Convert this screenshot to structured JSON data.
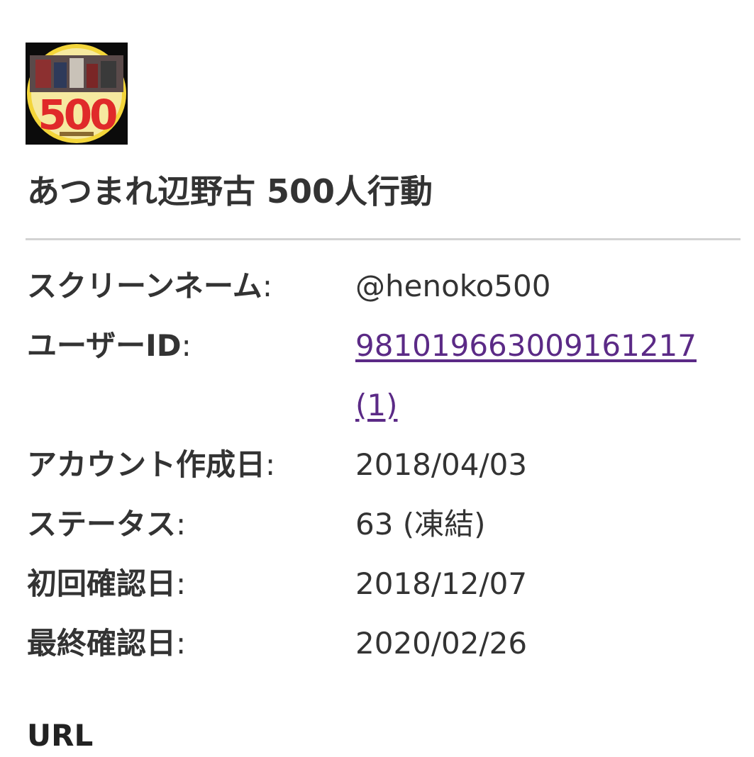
{
  "profile": {
    "avatar_icon": "profile-image-500",
    "avatar_text": "500",
    "avatar_colors": {
      "background": "#0b0b0b",
      "ring": "#f3d53a",
      "numeral": "#e02a2a"
    },
    "account_name": "あつまれ辺野古 500人行動"
  },
  "info": {
    "screen_name_label": "スクリーンネーム",
    "screen_name_value": "@henoko500",
    "user_id_label": "ユーザーID",
    "user_id_value": "981019663009161217",
    "user_id_count": "(1)",
    "created_label": "アカウント作成日",
    "created_value": "2018/04/03",
    "status_label": "ステータス",
    "status_value": "63 (凍結)",
    "first_seen_label": "初回確認日",
    "first_seen_value": "2018/12/07",
    "last_seen_label": "最終確認日",
    "last_seen_value": "2020/02/26",
    "colon": ":"
  },
  "sections": {
    "url_heading": "URL"
  },
  "colors": {
    "text": "#333333",
    "link": "#5b2a86",
    "divider": "#d3d3d3"
  }
}
